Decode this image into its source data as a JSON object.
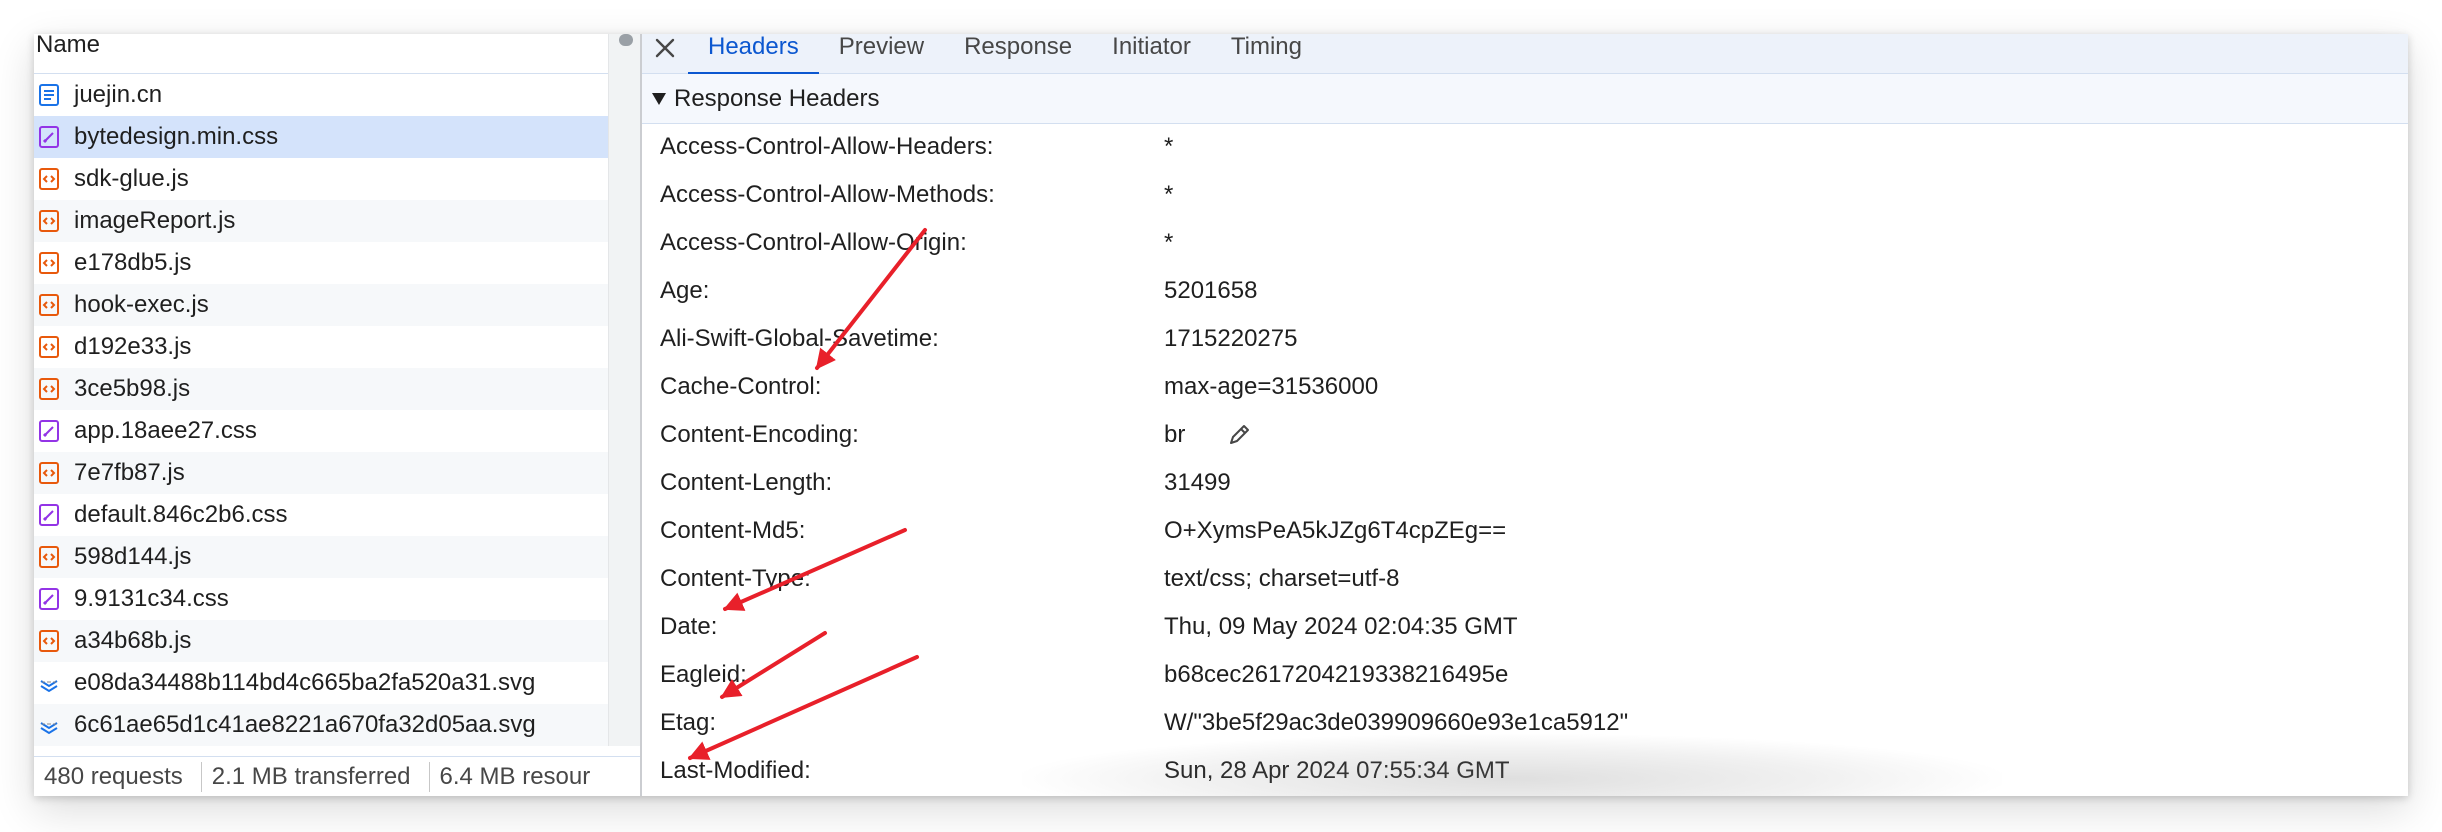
{
  "request_list": {
    "header_label": "Name",
    "rows": [
      {
        "name": "juejin.cn",
        "icon": "document-icon"
      },
      {
        "name": "bytedesign.min.css",
        "icon": "stylesheet-icon",
        "selected": true
      },
      {
        "name": "sdk-glue.js",
        "icon": "script-icon"
      },
      {
        "name": "imageReport.js",
        "icon": "script-icon"
      },
      {
        "name": "e178db5.js",
        "icon": "script-icon"
      },
      {
        "name": "hook-exec.js",
        "icon": "script-icon"
      },
      {
        "name": "d192e33.js",
        "icon": "script-icon"
      },
      {
        "name": "3ce5b98.js",
        "icon": "script-icon"
      },
      {
        "name": "app.18aee27.css",
        "icon": "stylesheet-icon"
      },
      {
        "name": "7e7fb87.js",
        "icon": "script-icon"
      },
      {
        "name": "default.846c2b6.css",
        "icon": "stylesheet-icon"
      },
      {
        "name": "598d144.js",
        "icon": "script-icon"
      },
      {
        "name": "9.9131c34.css",
        "icon": "stylesheet-icon"
      },
      {
        "name": "a34b68b.js",
        "icon": "script-icon"
      },
      {
        "name": "e08da34488b114bd4c665ba2fa520a31.svg",
        "icon": "svg-thumbnail-icon"
      },
      {
        "name": "6c61ae65d1c41ae8221a670fa32d05aa.svg",
        "icon": "svg-thumbnail-icon"
      }
    ]
  },
  "status_bar": {
    "requests": "480 requests",
    "transferred": "2.1 MB transferred",
    "resources": "6.4 MB resour"
  },
  "tabs": [
    "Headers",
    "Preview",
    "Response",
    "Initiator",
    "Timing"
  ],
  "active_tab": "Headers",
  "section_title": "Response Headers",
  "response_headers": [
    {
      "name": "Access-Control-Allow-Headers:",
      "value": "*"
    },
    {
      "name": "Access-Control-Allow-Methods:",
      "value": "*"
    },
    {
      "name": "Access-Control-Allow-Origin:",
      "value": "*"
    },
    {
      "name": "Age:",
      "value": "5201658"
    },
    {
      "name": "Ali-Swift-Global-Savetime:",
      "value": "1715220275"
    },
    {
      "name": "Cache-Control:",
      "value": "max-age=31536000"
    },
    {
      "name": "Content-Encoding:",
      "value": "br",
      "editable": true
    },
    {
      "name": "Content-Length:",
      "value": "31499"
    },
    {
      "name": "Content-Md5:",
      "value": "O+XymsPeA5kJZg6T4cpZEg=="
    },
    {
      "name": "Content-Type:",
      "value": "text/css; charset=utf-8"
    },
    {
      "name": "Date:",
      "value": "Thu, 09 May 2024 02:04:35 GMT"
    },
    {
      "name": "Eagleid:",
      "value": "b68cec2617204219338216495e"
    },
    {
      "name": "Etag:",
      "value": "W/\"3be5f29ac3de039909660e93e1ca5912\""
    },
    {
      "name": "Last-Modified:",
      "value": "Sun, 28 Apr 2024 07:55:34 GMT"
    }
  ],
  "colors": {
    "accent": "#0b57d0",
    "selected_row": "#d4e3fb",
    "annotation_arrow": "#e8202a",
    "script_icon": "#e8590c",
    "stylesheet_icon": "#9334e6",
    "document_icon": "#1a73e8"
  },
  "icons": {
    "close": "close-icon",
    "edit": "pencil-icon",
    "expand": "triangle-down-icon"
  }
}
